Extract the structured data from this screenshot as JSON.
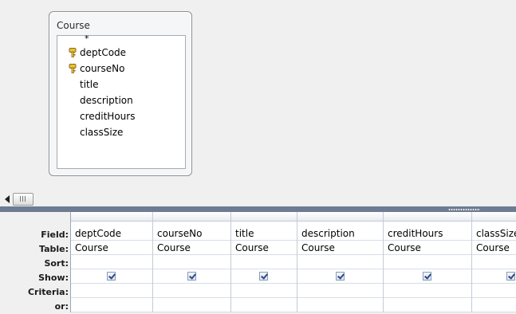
{
  "table": {
    "name": "Course",
    "fields": [
      {
        "label": "*",
        "is_key": false
      },
      {
        "label": "deptCode",
        "is_key": true
      },
      {
        "label": "courseNo",
        "is_key": true
      },
      {
        "label": "title",
        "is_key": false
      },
      {
        "label": "description",
        "is_key": false
      },
      {
        "label": "creditHours",
        "is_key": false
      },
      {
        "label": "classSize",
        "is_key": false
      }
    ]
  },
  "grid": {
    "row_labels": {
      "field": "Field:",
      "table": "Table:",
      "sort": "Sort:",
      "show": "Show:",
      "criteria": "Criteria:",
      "or": "or:"
    },
    "columns": [
      {
        "field": "deptCode",
        "table": "Course",
        "sort": "",
        "show": true,
        "criteria": "",
        "or": ""
      },
      {
        "field": "courseNo",
        "table": "Course",
        "sort": "",
        "show": true,
        "criteria": "",
        "or": ""
      },
      {
        "field": "title",
        "table": "Course",
        "sort": "",
        "show": true,
        "criteria": "",
        "or": ""
      },
      {
        "field": "description",
        "table": "Course",
        "sort": "",
        "show": true,
        "criteria": "",
        "or": ""
      },
      {
        "field": "creditHours",
        "table": "Course",
        "sort": "",
        "show": true,
        "criteria": "",
        "or": ""
      },
      {
        "field": "classSize",
        "table": "Course",
        "sort": "",
        "show": true,
        "criteria": "",
        "or": ""
      }
    ]
  },
  "colors": {
    "splitter": "#6d7c92",
    "grid_line": "#c3cbd7",
    "checkbox_mark": "#2a4a8a"
  }
}
